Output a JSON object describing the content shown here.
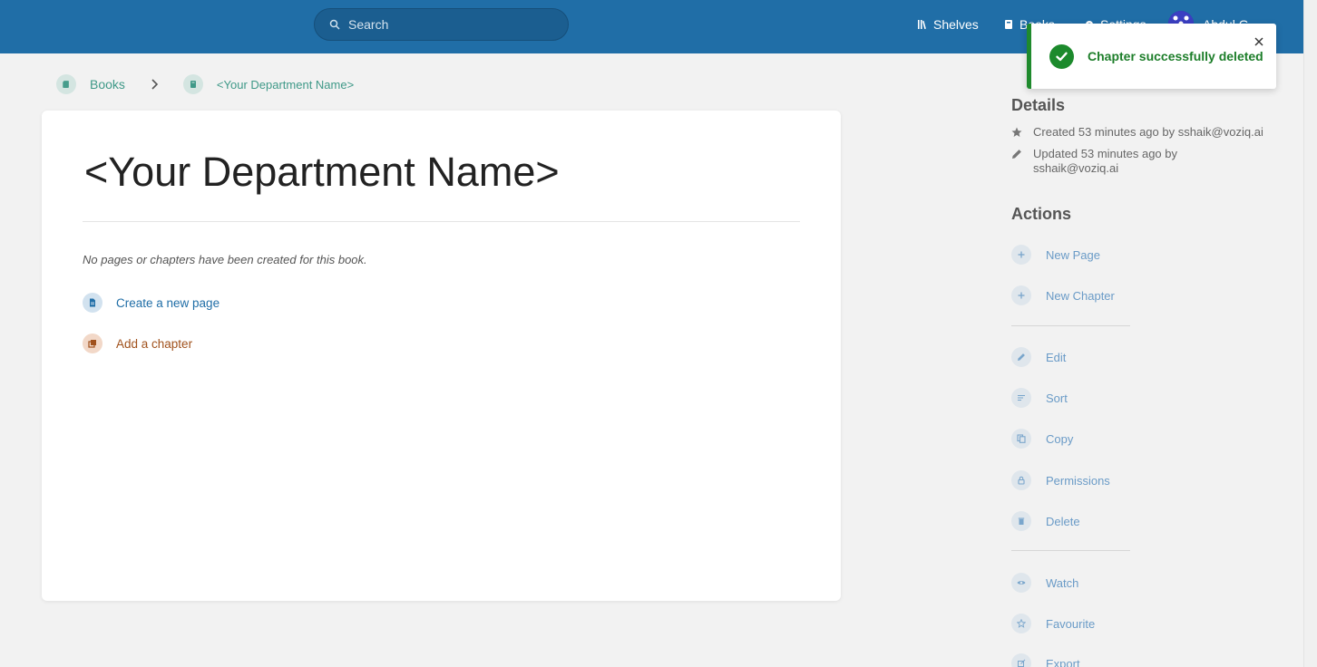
{
  "header": {
    "search_placeholder": "Search",
    "nav": {
      "shelves": "Shelves",
      "books": "Books",
      "settings": "Settings",
      "user": "Abdul G"
    }
  },
  "breadcrumb": {
    "items": [
      {
        "label": "Books"
      },
      {
        "label": "<Your Department Name>"
      }
    ]
  },
  "main": {
    "title": "<Your Department Name>",
    "empty_message": "No pages or chapters have been created for this book.",
    "create_page": "Create a new page",
    "add_chapter": "Add a chapter"
  },
  "sidebar": {
    "details_heading": "Details",
    "created": "Created 53 minutes ago by sshaik@voziq.ai",
    "updated": "Updated 53 minutes ago by sshaik@voziq.ai",
    "actions_heading": "Actions",
    "actions": {
      "new_page": "New Page",
      "new_chapter": "New Chapter",
      "edit": "Edit",
      "sort": "Sort",
      "copy": "Copy",
      "permissions": "Permissions",
      "delete": "Delete",
      "watch": "Watch",
      "favourite": "Favourite",
      "export": "Export"
    }
  },
  "toast": {
    "message": "Chapter successfully deleted"
  },
  "colors": {
    "header": "#206ea7",
    "book_accent": "#3f9988",
    "chapter_accent": "#a0511c",
    "success": "#1f8a2d"
  }
}
